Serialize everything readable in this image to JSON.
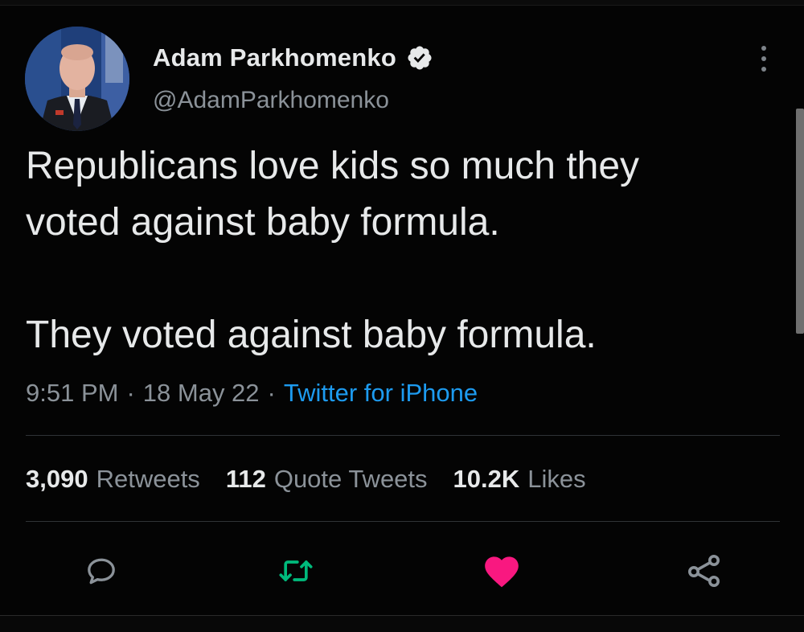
{
  "user": {
    "display_name": "Adam Parkhomenko",
    "handle": "@AdamParkhomenko",
    "verified": true
  },
  "tweet": {
    "text": "Republicans love kids so much they\nvoted against baby formula.\n\nThey voted against baby formula.",
    "time": "9:51 PM",
    "date": "18 May 22",
    "source": "Twitter for iPhone",
    "separator": "·"
  },
  "stats": {
    "retweets": {
      "count": "3,090",
      "label": "Retweets"
    },
    "quotes": {
      "count": "112",
      "label": "Quote Tweets"
    },
    "likes": {
      "count": "10.2K",
      "label": "Likes"
    }
  },
  "actions": [
    {
      "icon": "reply-icon"
    },
    {
      "icon": "retweet-icon",
      "color": "#00ba7c"
    },
    {
      "icon": "like-icon",
      "color": "#f91880"
    },
    {
      "icon": "share-icon"
    }
  ],
  "colors": {
    "background": "#040404",
    "text": "#e7e9ea",
    "secondary": "#8b9299",
    "link": "#1d9bf0",
    "retweet": "#00ba7c",
    "like": "#f91880"
  }
}
